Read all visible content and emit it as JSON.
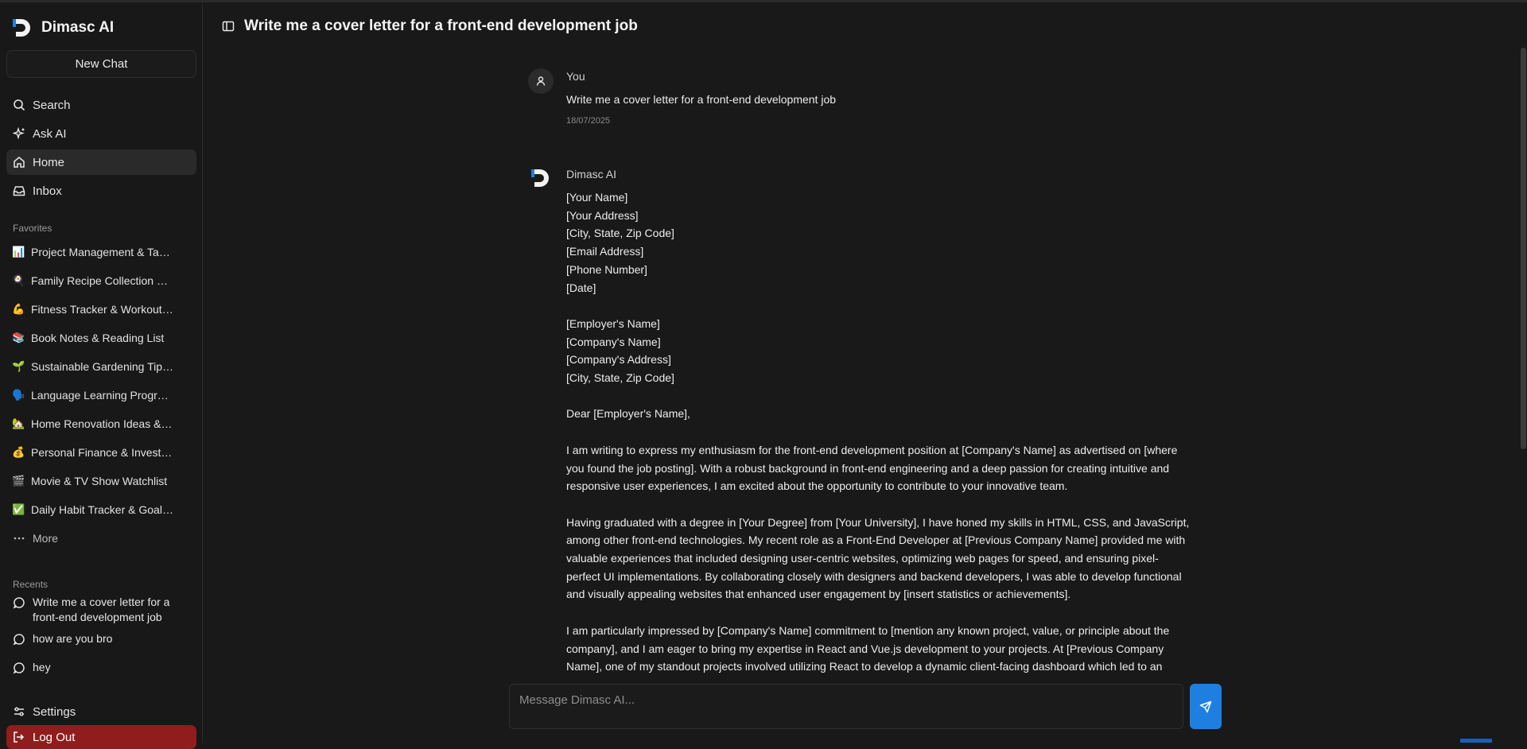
{
  "app": {
    "name": "Dimasc AI"
  },
  "sidebar": {
    "new_chat": "New Chat",
    "nav": [
      {
        "label": "Search",
        "icon": "search-icon"
      },
      {
        "label": "Ask AI",
        "icon": "sparkles-icon"
      },
      {
        "label": "Home",
        "icon": "home-icon",
        "active": true
      },
      {
        "label": "Inbox",
        "icon": "inbox-icon"
      }
    ],
    "favorites_label": "Favorites",
    "favorites": [
      {
        "emoji": "📊",
        "label": "Project Management & Task Tracker"
      },
      {
        "emoji": "🍳",
        "label": "Family Recipe Collection & Meal Plans"
      },
      {
        "emoji": "💪",
        "label": "Fitness Tracker & Workout Routines"
      },
      {
        "emoji": "📚",
        "label": "Book Notes & Reading List"
      },
      {
        "emoji": "🌱",
        "label": "Sustainable Gardening Tips & Plans"
      },
      {
        "emoji": "🗣️",
        "label": "Language Learning Progress"
      },
      {
        "emoji": "🏡",
        "label": "Home Renovation Ideas & Budget"
      },
      {
        "emoji": "💰",
        "label": "Personal Finance & Investment Tracker"
      },
      {
        "emoji": "🎬",
        "label": "Movie & TV Show Watchlist"
      },
      {
        "emoji": "✅",
        "label": "Daily Habit Tracker & Goal Setting"
      }
    ],
    "more": "More",
    "recents_label": "Recents",
    "recents": [
      {
        "label": "Write me a cover letter for a front-end development job"
      },
      {
        "label": "how are you bro"
      },
      {
        "label": "hey"
      }
    ],
    "settings": "Settings",
    "logout": "Log Out"
  },
  "chat": {
    "title": "Write me a cover letter for a front-end development job",
    "user_message": {
      "author": "You",
      "text": "Write me a cover letter for a front-end development job",
      "date": "18/07/2025"
    },
    "ai_message": {
      "author": "Dimasc AI",
      "lines": [
        "[Your Name]",
        "[Your Address]",
        "[City, State, Zip Code]",
        "[Email Address]",
        "[Phone Number]",
        "[Date]",
        "",
        "[Employer's Name]",
        "[Company's Name]",
        "[Company's Address]",
        "[City, State, Zip Code]",
        "",
        "Dear [Employer's Name],",
        "",
        "I am writing to express my enthusiasm for the front-end development position at [Company's Name] as advertised on [where",
        "you found the job posting]. With a robust background in front-end engineering and a deep passion for creating intuitive and",
        "responsive user experiences, I am excited about the opportunity to contribute to your innovative team.",
        "",
        "Having graduated with a degree in [Your Degree] from [Your University], I have honed my skills in HTML, CSS, and JavaScript,",
        "among other front-end technologies. My recent role as a Front-End Developer at [Previous Company Name] provided me with",
        "valuable experiences that included designing user-centric websites, optimizing web pages for speed, and ensuring pixel-",
        "perfect UI implementations. By collaborating closely with designers and backend developers, I was able to develop functional",
        "and visually appealing websites that enhanced user engagement by [insert statistics or achievements].",
        "",
        "I am particularly impressed by [Company's Name] commitment to [mention any known project, value, or principle about the",
        "company], and I am eager to bring my expertise in React and Vue.js development to your projects. At [Previous Company",
        "Name], one of my standout projects involved utilizing React to develop a dynamic client-facing dashboard which led to an"
      ]
    }
  },
  "composer": {
    "placeholder": "Message Dimasc AI..."
  },
  "colors": {
    "accent": "#1f7fe0",
    "logout": "#8f1d1d",
    "background": "#191919"
  }
}
